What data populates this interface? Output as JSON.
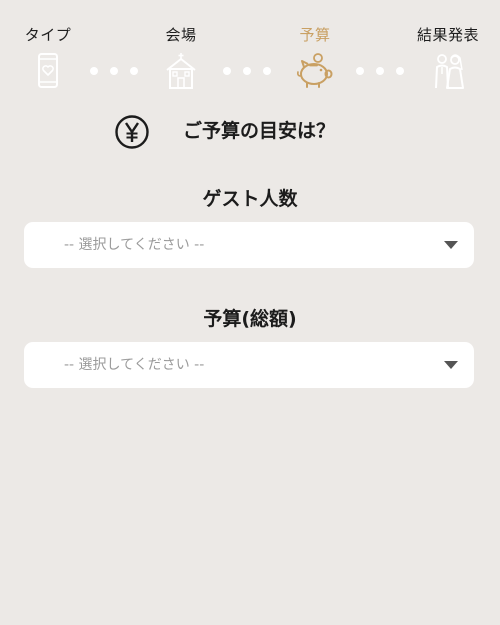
{
  "steps": [
    {
      "label": "タイプ",
      "icon": "smartphone-heart-icon",
      "active": false
    },
    {
      "label": "会場",
      "icon": "venue-building-icon",
      "active": false
    },
    {
      "label": "予算",
      "icon": "piggy-bank-icon",
      "active": true
    },
    {
      "label": "結果発表",
      "icon": "couple-icon",
      "active": false
    }
  ],
  "colors": {
    "active": "#c9a063",
    "inactive_icon": "#ffffff",
    "background": "#ece9e6"
  },
  "question": {
    "icon": "yen-icon",
    "title": "ご予算の目安は？"
  },
  "fields": [
    {
      "label": "ゲスト人数",
      "placeholder": "-- 選択してください --"
    },
    {
      "label": "予算(総額)",
      "placeholder": "-- 選択してください --"
    }
  ]
}
